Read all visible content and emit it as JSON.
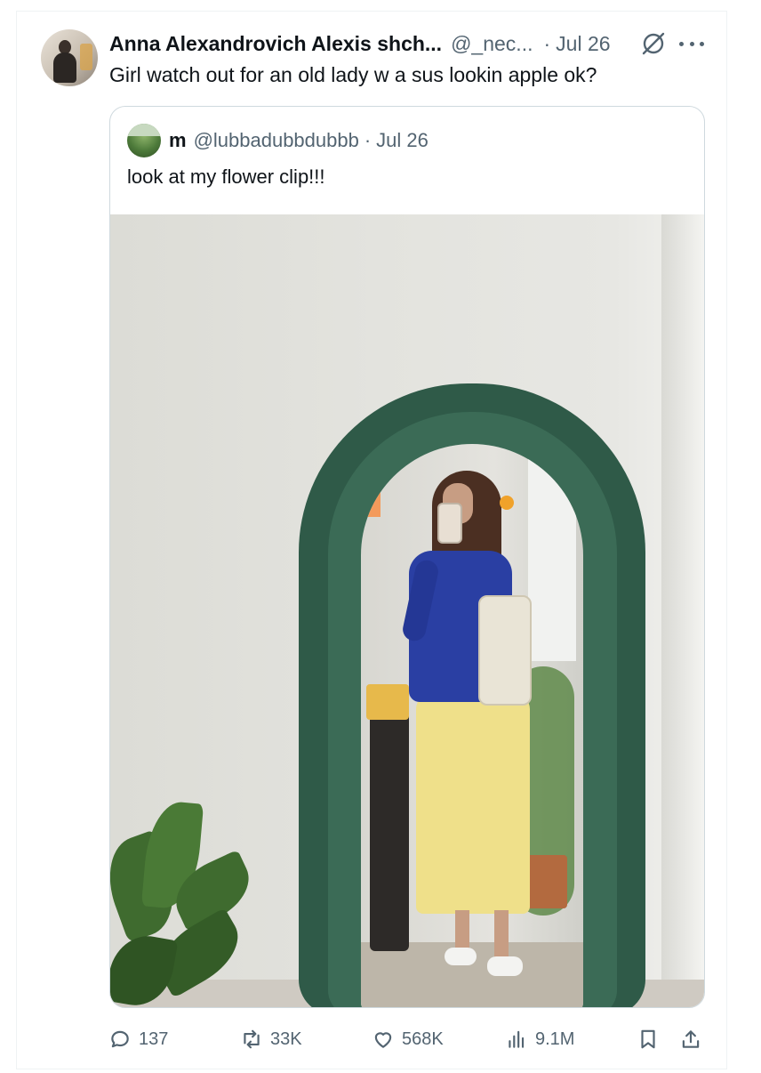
{
  "tweet": {
    "author_name": "Anna Alexandrovich Alexis shch...",
    "author_handle": "@_nec...",
    "separator": "·",
    "date": "Jul 26",
    "text": "Girl watch out for an old lady w a sus lookin apple ok?"
  },
  "quoted": {
    "author_name": "m",
    "author_handle": "@lubbadubbdubbb",
    "separator": "·",
    "date": "Jul 26",
    "text": "look at my flower clip!!!"
  },
  "metrics": {
    "replies": "137",
    "reposts": "33K",
    "likes": "568K",
    "views": "9.1M"
  },
  "colors": {
    "text": "#0f1419",
    "muted": "#536471",
    "border": "#cfd9de"
  },
  "icons": [
    "grok-icon",
    "more-icon",
    "reply-icon",
    "repost-icon",
    "like-icon",
    "views-icon",
    "bookmark-icon",
    "share-icon"
  ]
}
